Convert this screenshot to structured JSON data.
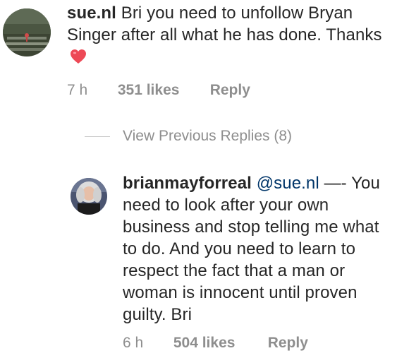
{
  "comment": {
    "username": "sue.nl",
    "text": "Bri you need to unfollow Bryan Singer after all what he has done. Thanks",
    "time": "7 h",
    "likes": "351 likes",
    "reply_label": "Reply",
    "heart_icon": "red-heart-emoji"
  },
  "view_previous_replies": {
    "label": "View Previous Replies (8)"
  },
  "reply": {
    "username": "brianmayforreal",
    "mention": "@sue.nl",
    "text_lead": " —-",
    "text": "You need to look after your own business and stop telling me what to do. And you need to learn to respect the fact that a man or woman is innocent until proven guilty. Bri",
    "time": "6 h",
    "likes": "504 likes",
    "reply_label": "Reply"
  },
  "colors": {
    "text": "#262626",
    "meta": "#8e8e8e",
    "mention": "#003569",
    "heart": "#ed4956"
  }
}
